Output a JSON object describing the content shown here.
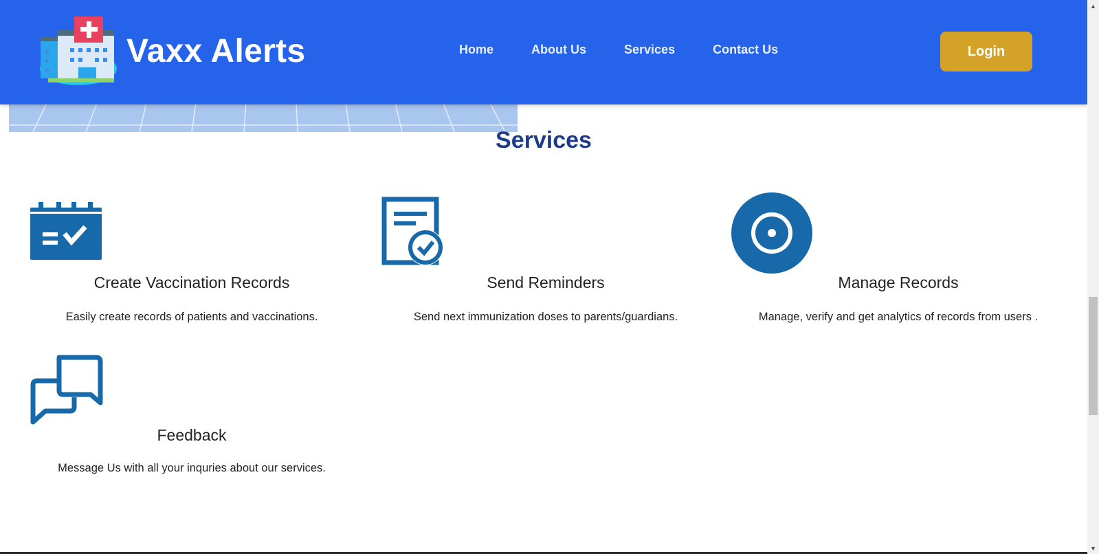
{
  "header": {
    "brand_name": "Vaxx Alerts",
    "logo_icon": "hospital-icon",
    "nav": [
      "Home",
      "About Us",
      "Services",
      "Contact Us"
    ],
    "login_label": "Login",
    "colors": {
      "bar": "#2563eb",
      "login": "#d4a227"
    }
  },
  "services": {
    "title": "Services",
    "items": [
      {
        "icon": "calendar-check-icon",
        "title": "Create Vaccination Records",
        "desc": "Easily create records of patients and vaccinations."
      },
      {
        "icon": "document-check-icon",
        "title": "Send Reminders",
        "desc": "Send next immunization doses to parents/guardians."
      },
      {
        "icon": "disc-icon",
        "title": "Manage Records",
        "desc": "Manage, verify and get analytics of records from users ."
      },
      {
        "icon": "chat-bubbles-icon",
        "title": "Feedback",
        "desc": "Message Us with all your inquries about our services."
      }
    ],
    "icon_color": "#1769aa",
    "title_color": "#1e3a8a"
  }
}
